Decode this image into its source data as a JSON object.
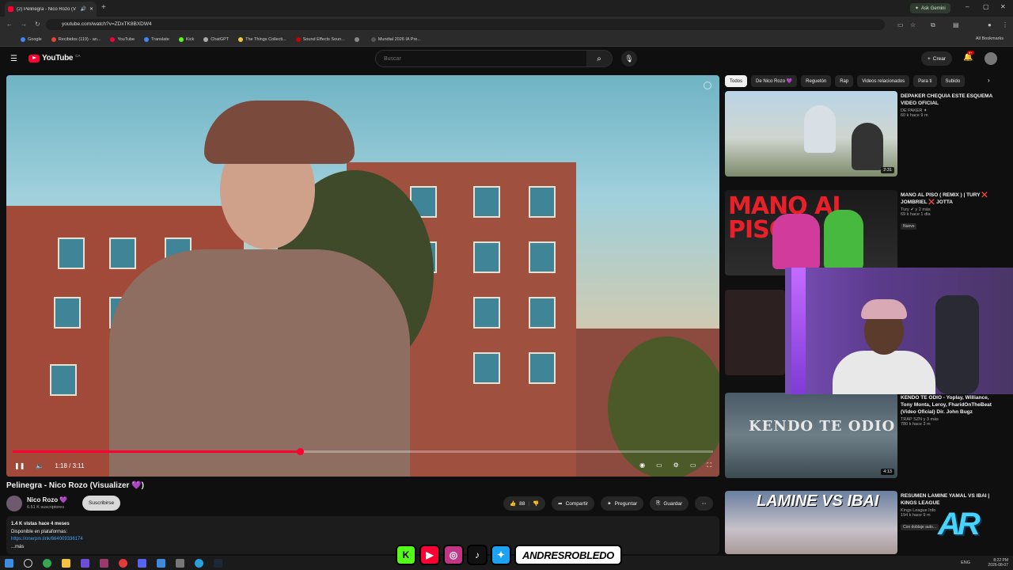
{
  "browser": {
    "tab_title": "(2) Pelinegra - Nico Rozo (V",
    "new_tab": "+",
    "gemini_label": "Ask Gemini",
    "url": "youtube.com/watch?v=ZDxTK8BXDW4",
    "bookmarks": [
      {
        "label": "Google",
        "color": "#4285f4"
      },
      {
        "label": "Recibidos (119) - an...",
        "color": "#ea4335"
      },
      {
        "label": "YouTube",
        "color": "#ff0033"
      },
      {
        "label": "Translate",
        "color": "#4285f4"
      },
      {
        "label": "Kick",
        "color": "#53fc18"
      },
      {
        "label": "ChatGPT",
        "color": "#aaaaaa"
      },
      {
        "label": "The Things Collecti...",
        "color": "#f5c242"
      },
      {
        "label": "Sound Effects Soun...",
        "color": "#cc0000"
      },
      {
        "label": "",
        "color": "#888888"
      },
      {
        "label": "Mundial 2026 IA Pre...",
        "color": "#555555"
      }
    ],
    "all_bookmarks": "All Bookmarks"
  },
  "youtube": {
    "logo_text": "YouTube",
    "country": "CA",
    "search_placeholder": "Buscar",
    "create_label": "Crear",
    "notifications": "9+"
  },
  "player": {
    "current_time": "1:18",
    "duration": "3:11",
    "time_display": "1:18 / 3:11",
    "progress": 0.41
  },
  "video": {
    "title": "Pelinegra - Nico Rozo (Visualizer 💜)",
    "channel": "Nico Rozo 💜",
    "subscribers": "6.51 K suscriptores",
    "subscribe_label": "Suscribirse",
    "likes": "88",
    "share_label": "Compartir",
    "ask_label": "Preguntar",
    "save_label": "Guardar",
    "views_date": "1.4 K vistas  hace 4 meses",
    "platforms": "Disponible en plataformas:",
    "link": "https://onerpm.link/664009336174",
    "more": "...más"
  },
  "chips": [
    "Todos",
    "De Nico Rozo 💜",
    "Reguetón",
    "Rap",
    "Videos relacionados",
    "Para ti",
    "Subido"
  ],
  "recommendations": [
    {
      "title": "DEPAKER CHEQUIA ESTE ESQUEMA VIDEO OFICIAL",
      "channel": "DE PAKER ✦",
      "views": "60 k  hace 9 m",
      "duration": "2:31",
      "badge": ""
    },
    {
      "title": "MANO AL PISO ( REMIX ) | TURY ❌ JOMBRIEL ❌ JOTTA",
      "channel": "Tury ✔ y 2 más",
      "views": "69 k  hace 1 día",
      "duration": "",
      "badge": "Nuevo"
    },
    {
      "title": "KENDO TE ODIO - Yoplay, Williance, Tony Monta, Leroy, FharidOnTheBeat (Video Oficial) Dir. John Bugz",
      "channel": "TRAP SZN y 3 más",
      "views": "780 k  hace 3 m",
      "duration": "4:13",
      "badge": ""
    },
    {
      "title": "RESUMEN LAMINE YAMAL VS IBAI | KINGS LEAGUE",
      "channel": "Kings League Info",
      "views": "194 k  hace 9 m",
      "duration": "",
      "badge": "Con doblaje auto..."
    }
  ],
  "thumb_texts": {
    "mano_al_piso": "MANO AL PISO",
    "kendo": "KENDO TE ODIO",
    "lamine": "LAMINE VS IBAI"
  },
  "overlay": {
    "handle": "ANDRESROBLEDO",
    "watermark": "AR",
    "social_icons": [
      "kick-icon",
      "youtube-icon",
      "instagram-icon",
      "tiktok-icon",
      "twitter-icon"
    ]
  },
  "taskbar": {
    "lang": "ENG",
    "time": "8:22 PM",
    "date": "2026-08-07"
  }
}
